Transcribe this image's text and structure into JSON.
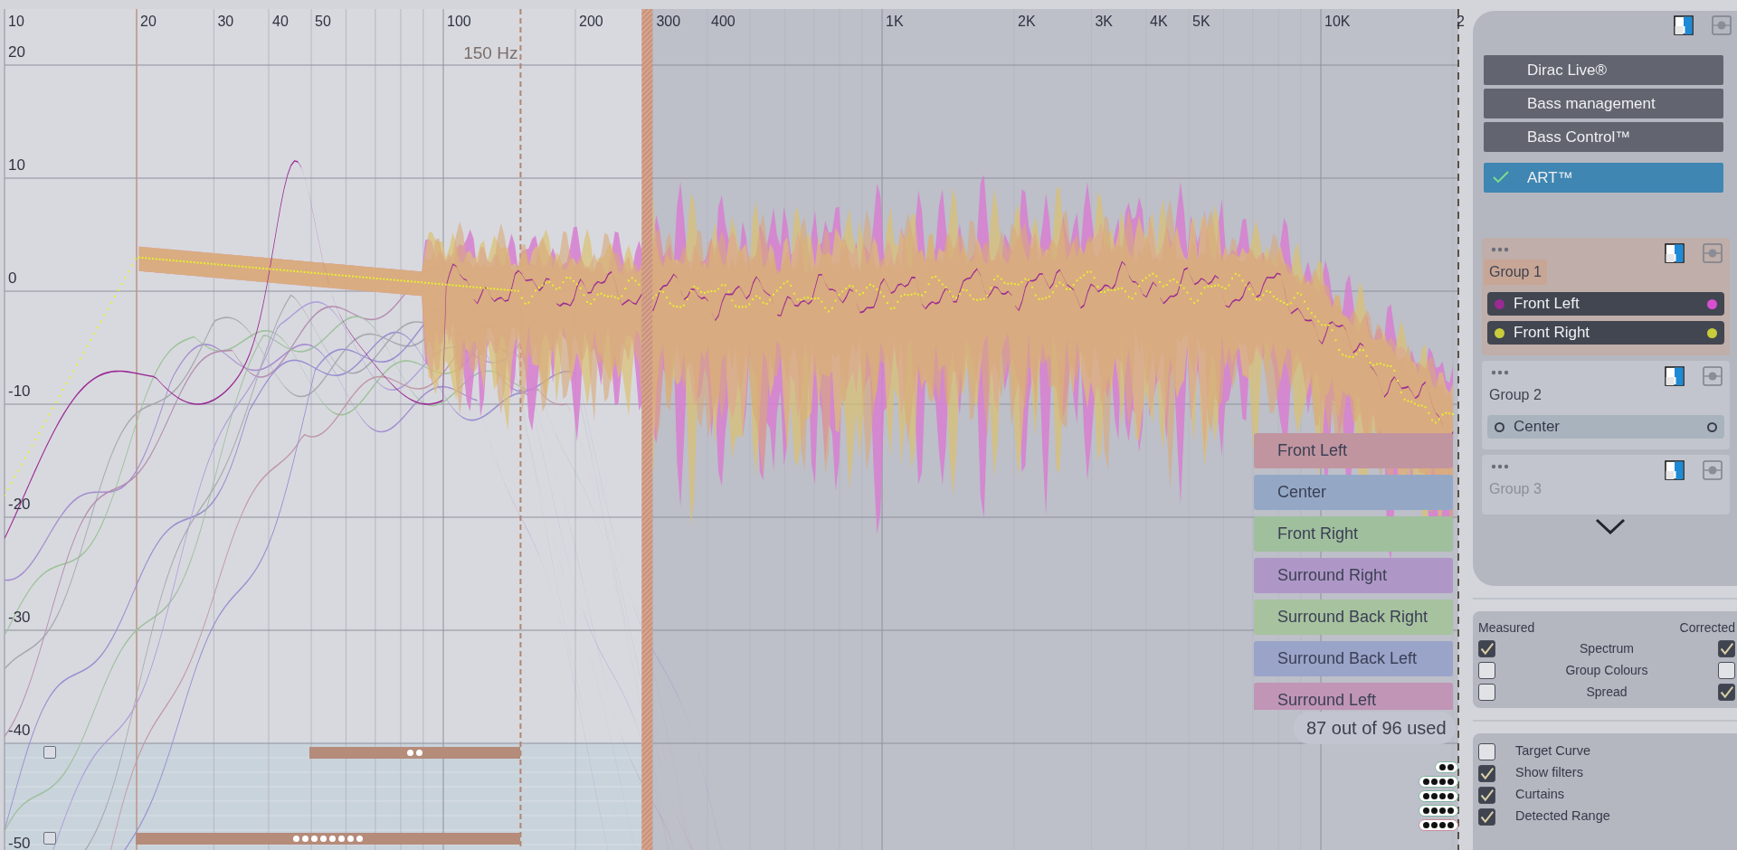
{
  "chart": {
    "x_ticks": [
      "10",
      "20",
      "30",
      "40",
      "50",
      "100",
      "200",
      "300",
      "400",
      "1K",
      "2K",
      "3K",
      "4K",
      "5K",
      "10K",
      "2"
    ],
    "y_ticks": [
      "20",
      "10",
      "0",
      "-10",
      "-20",
      "-30",
      "-40",
      "-50"
    ],
    "crossover_label": "150 Hz",
    "legend": [
      {
        "label": "Front Left",
        "color": "#c0959f"
      },
      {
        "label": "Center",
        "color": "#94a8c6"
      },
      {
        "label": "Front Right",
        "color": "#9fbf9d"
      },
      {
        "label": "Surround Right",
        "color": "#ae97c6"
      },
      {
        "label": "Surround Back Right",
        "color": "#a7c29e"
      },
      {
        "label": "Surround Back Left",
        "color": "#9aa3c8"
      },
      {
        "label": "Surround Left",
        "color": "#c095b5"
      }
    ],
    "usage": "87 out of 96 used",
    "filter_rows": [
      {
        "checked": false
      },
      {
        "checked": false
      }
    ],
    "filter_pills": [
      {
        "kind": "pair",
        "color": "#7fb39c"
      },
      {
        "kind": "quad",
        "color": "#7fb39c"
      },
      {
        "kind": "quad",
        "color": "#7fb39c"
      },
      {
        "kind": "quad",
        "color": "#7fb39c"
      },
      {
        "kind": "quad",
        "color": "#c98a98"
      }
    ]
  },
  "sidebar": {
    "menu": [
      {
        "label": "Dirac Live®",
        "selected": false
      },
      {
        "label": "Bass management",
        "selected": false
      },
      {
        "label": "Bass Control™",
        "selected": false
      },
      {
        "label": "ART™",
        "selected": true
      }
    ],
    "groups": [
      {
        "title": "Group 1",
        "selected": true,
        "channels": [
          {
            "name": "Front Left",
            "on": true,
            "markers": [
              {
                "color": "#9a2a94"
              },
              {
                "color": "#d94fd2"
              }
            ]
          },
          {
            "name": "Front Right",
            "on": true,
            "markers": [
              {
                "color": "#c9cc3a"
              },
              {
                "color": "#c9cc3a"
              }
            ]
          }
        ]
      },
      {
        "title": "Group 2",
        "selected": false,
        "channels": [
          {
            "name": "Center",
            "on": false
          }
        ]
      },
      {
        "title": "Group 3",
        "selected": false,
        "faded": true
      }
    ]
  },
  "display": {
    "headers": [
      "Measured",
      "Corrected"
    ],
    "rows": [
      {
        "label": "Spectrum",
        "measured": true,
        "corrected": true
      },
      {
        "label": "Group Colours",
        "measured": false,
        "corrected": false
      },
      {
        "label": "Spread",
        "measured": false,
        "corrected": true
      }
    ]
  },
  "options": [
    {
      "label": "Target Curve",
      "checked": false
    },
    {
      "label": "Show filters",
      "checked": true
    },
    {
      "label": "Curtains",
      "checked": true
    },
    {
      "label": "Detected Range",
      "checked": true
    }
  ]
}
